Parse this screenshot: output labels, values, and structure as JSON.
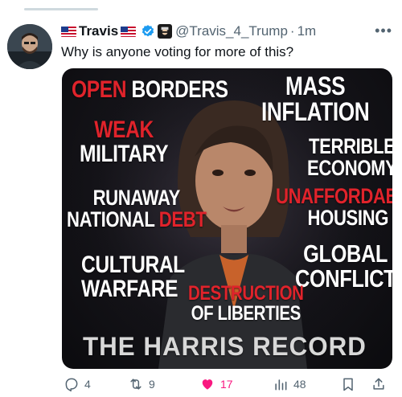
{
  "tweet": {
    "display_name": "Travis",
    "handle": "@Travis_4_Trump",
    "separator": "·",
    "time": "1m",
    "text": "Why is anyone voting for more of this?",
    "more_icon": "ellipsis-icon",
    "verified_icon": "verified-badge-icon"
  },
  "media": {
    "lines": {
      "open": "Open",
      "borders": " Borders",
      "mass": "Mass",
      "inflation": "Inflation",
      "weak": "Weak",
      "military": "Military",
      "terrible": "Terrible",
      "economy": "Economy",
      "runaway": "Runaway",
      "national": "National ",
      "debt": "Debt",
      "unaffordable": "Unaffordable",
      "housing": "Housing",
      "cultural": "Cultural",
      "warfare": "Warfare",
      "global": "Global",
      "conflict": "Conflict",
      "destruction": "Destruction",
      "of_liberties": "of Liberties",
      "record": "The Harris Record"
    }
  },
  "actions": {
    "replies": "4",
    "retweets": "9",
    "likes": "17",
    "views": "48"
  },
  "colors": {
    "accent_like": "#f91880",
    "verified": "#1d9bf0",
    "poster_red": "#e0232b",
    "muted_text": "#536471"
  }
}
